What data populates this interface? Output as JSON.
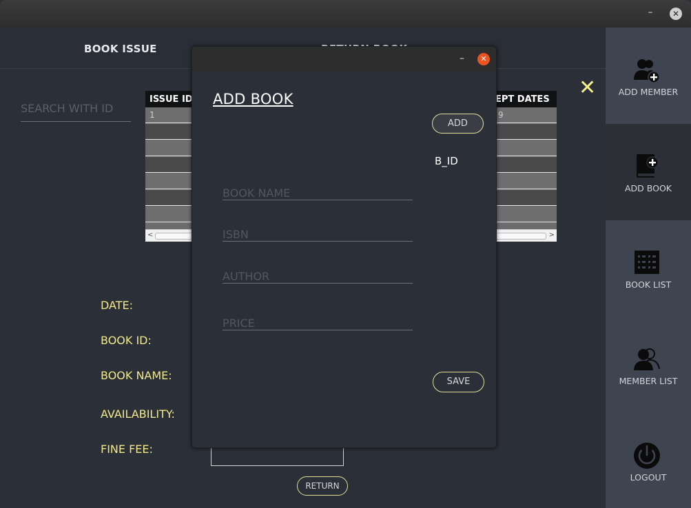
{
  "window": {
    "minimize": "–",
    "close": "✕"
  },
  "tabs": {
    "issue": "BOOK ISSUE",
    "return": "RETURN BOOK"
  },
  "search": {
    "placeholder": "SEARCH WITH ID"
  },
  "table": {
    "columns": [
      "ISSUE ID",
      "EPT DATES"
    ],
    "rows": [
      [
        "1",
        "9"
      ],
      [
        "",
        ""
      ],
      [
        "",
        ""
      ],
      [
        "",
        ""
      ],
      [
        "",
        ""
      ],
      [
        "",
        ""
      ],
      [
        "",
        ""
      ]
    ]
  },
  "close_panel": "✕",
  "form": {
    "date": "DATE:",
    "book_id": "BOOK ID:",
    "book_name": "BOOK NAME:",
    "availability": "AVAILABILITY:",
    "fine_fee": "FINE FEE:",
    "return_label": "RETURN"
  },
  "sidebar": {
    "items": [
      {
        "label": "ADD MEMBER",
        "icon": "add-member-icon"
      },
      {
        "label": "ADD BOOK",
        "icon": "add-book-icon"
      },
      {
        "label": "BOOK LIST",
        "icon": "book-list-icon"
      },
      {
        "label": "MEMBER LIST",
        "icon": "member-list-icon"
      },
      {
        "label": "LOGOUT",
        "icon": "power-icon"
      }
    ]
  },
  "dialog": {
    "minimize": "–",
    "close": "✕",
    "heading": "ADD BOOK",
    "add_label": "ADD",
    "bid_label": "B_ID",
    "fields": {
      "book_name": "BOOK NAME",
      "isbn": "ISBN",
      "author": "AUTHOR",
      "price": "PRICE"
    },
    "save_label": "SAVE"
  },
  "colors": {
    "accent_yellow": "#f2e98c",
    "close_orange": "#e95420",
    "sidebar_bg": "#3f4451"
  }
}
